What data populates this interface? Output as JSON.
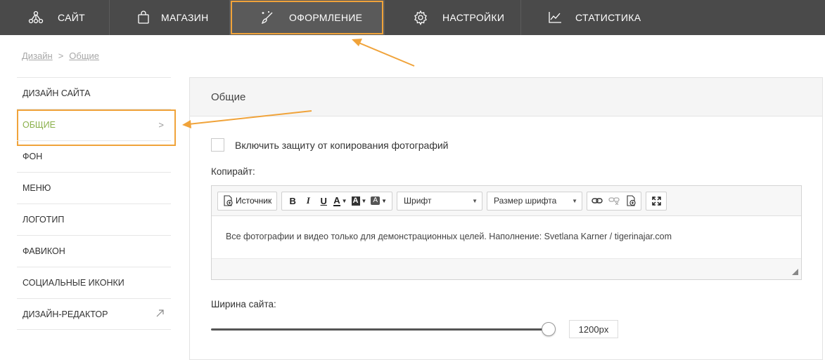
{
  "topnav": {
    "items": [
      {
        "label": "САЙТ",
        "icon": "site-nodes-icon"
      },
      {
        "label": "МАГАЗИН",
        "icon": "shopping-bag-icon"
      },
      {
        "label": "ОФОРМЛЕНИЕ",
        "icon": "magic-brush-icon",
        "active": true
      },
      {
        "label": "НАСТРОЙКИ",
        "icon": "gear-icon"
      },
      {
        "label": "СТАТИСТИКА",
        "icon": "line-chart-icon"
      }
    ]
  },
  "breadcrumb": {
    "root": "Дизайн",
    "separator": ">",
    "current": "Общие"
  },
  "sidebar": {
    "items": [
      {
        "label": "ДИЗАЙН САЙТА"
      },
      {
        "label": "ОБЩИЕ",
        "active": true,
        "chevron": ">"
      },
      {
        "label": "ФОН"
      },
      {
        "label": "МЕНЮ"
      },
      {
        "label": "ЛОГОТИП"
      },
      {
        "label": "ФАВИКОН"
      },
      {
        "label": "СОЦИАЛЬНЫЕ ИКОНКИ"
      },
      {
        "label": "ДИЗАЙН-РЕДАКТОР",
        "icon": "external-arrow-icon"
      }
    ]
  },
  "panel": {
    "title": "Общие",
    "protect_label": "Включить защиту от копирования фотографий",
    "protect_checked": false,
    "copyright_label": "Копирайт:",
    "toolbar": {
      "source_label": "Источник",
      "bold": "B",
      "italic": "I",
      "underline": "U",
      "text_color": "A",
      "bg_color": "A",
      "style_label": "A",
      "font_label": "Шрифт",
      "size_label": "Размер шрифта"
    },
    "copyright_text": "Все фотографии и видео только для демонстрационных целей. Наполнение: Svetlana Karner / tigerinajar.com",
    "width_label": "Ширина сайта:",
    "width_value": "1200px",
    "width_slider_fraction": 0.98
  },
  "colors": {
    "nav_bg": "#4a4a4a",
    "highlight": "#f0a33a",
    "active_text": "#8ab04a"
  }
}
